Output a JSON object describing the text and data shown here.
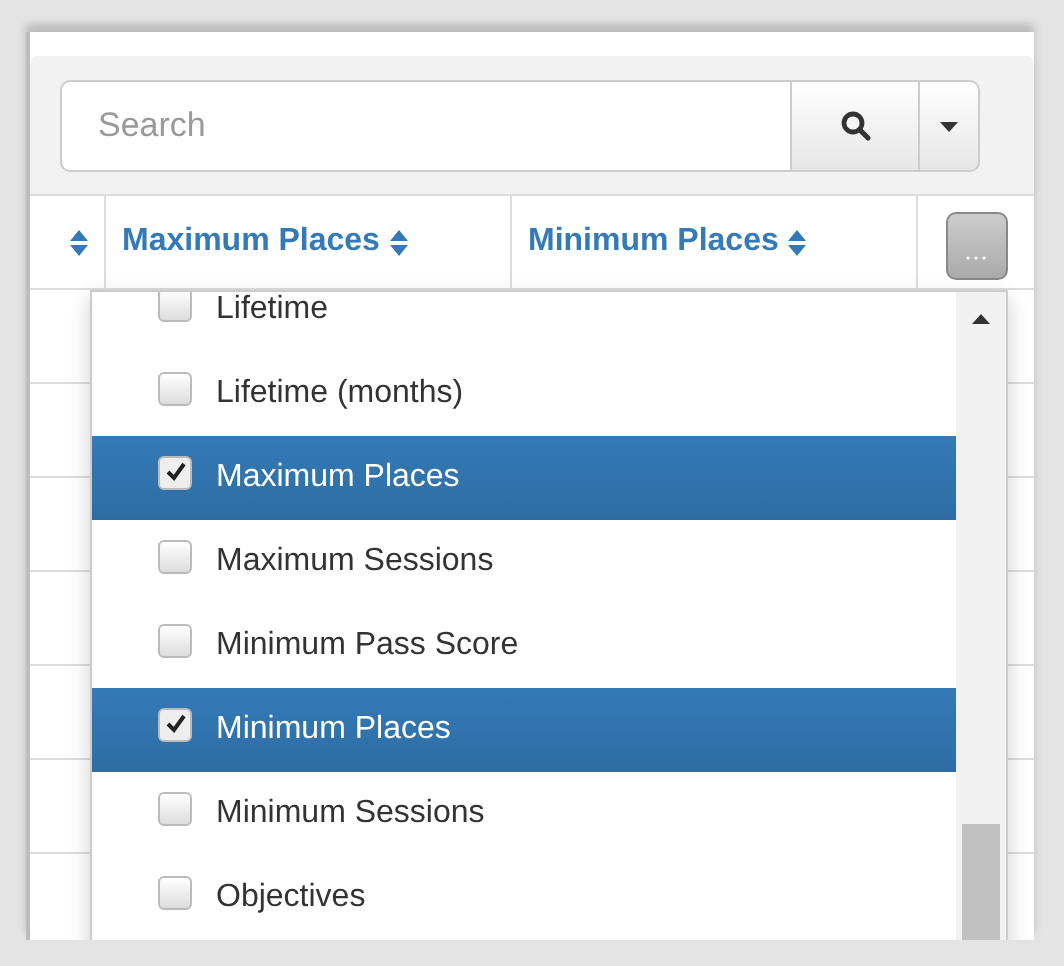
{
  "search": {
    "placeholder": "Search"
  },
  "table": {
    "columns": [
      {},
      {
        "label": "Maximum Places"
      },
      {
        "label": "Minimum Places"
      }
    ]
  },
  "column_menu": {
    "items": [
      {
        "label": "Lifetime",
        "checked": false
      },
      {
        "label": "Lifetime (months)",
        "checked": false
      },
      {
        "label": "Maximum Places",
        "checked": true
      },
      {
        "label": "Maximum Sessions",
        "checked": false
      },
      {
        "label": "Minimum Pass Score",
        "checked": false
      },
      {
        "label": "Minimum Places",
        "checked": true
      },
      {
        "label": "Minimum Sessions",
        "checked": false
      },
      {
        "label": "Objectives",
        "checked": false
      }
    ]
  }
}
